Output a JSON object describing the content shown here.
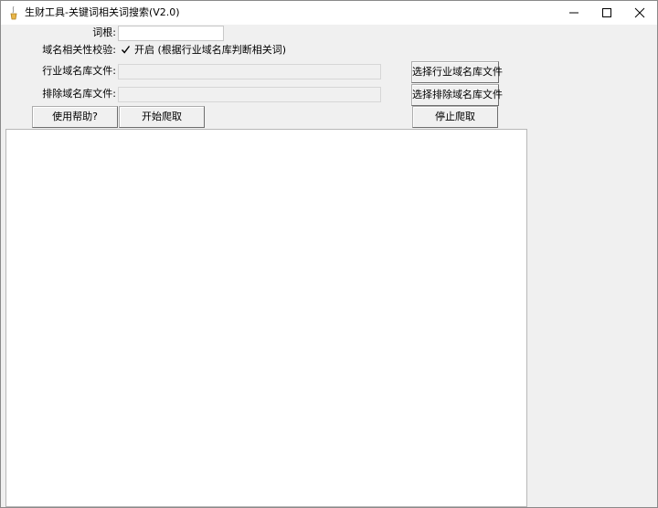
{
  "window": {
    "title": "生财工具-关键词相关词搜索(V2.0)"
  },
  "form": {
    "keyword_label": "词根:",
    "keyword_value": "",
    "relevance_label": "域名相关性校验:",
    "relevance_checked": true,
    "relevance_check_label": "开启 (根据行业域名库判断相关词)",
    "industry_file_label": "行业域名库文件:",
    "industry_file_value": "",
    "exclude_file_label": "排除域名库文件:",
    "exclude_file_value": ""
  },
  "buttons": {
    "select_industry": "选择行业域名库文件",
    "select_exclude": "选择排除域名库文件",
    "help": "使用帮助?",
    "start": "开始爬取",
    "stop": "停止爬取"
  },
  "output": {
    "text": ""
  }
}
